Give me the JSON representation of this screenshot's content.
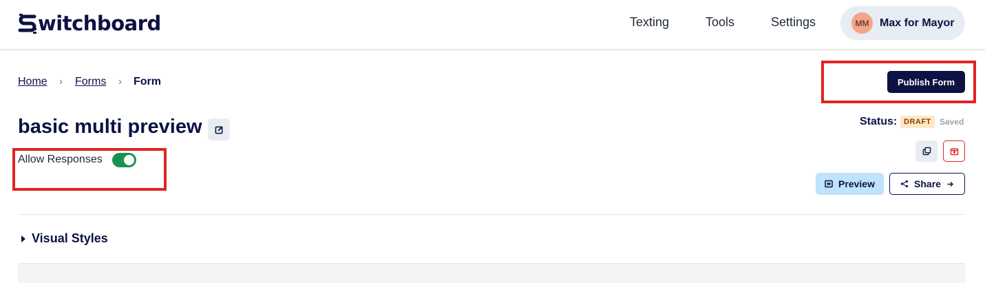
{
  "header": {
    "logo_text": "witchboard",
    "nav": [
      "Texting",
      "Tools",
      "Settings"
    ],
    "account": {
      "initials": "MM",
      "name": "Max for Mayor"
    }
  },
  "breadcrumb": {
    "home": "Home",
    "forms": "Forms",
    "current": "Form",
    "separator": "›"
  },
  "actions": {
    "publish_label": "Publish Form",
    "preview_label": "Preview",
    "share_label": "Share"
  },
  "form": {
    "title": "basic multi preview",
    "allow_responses_label": "Allow Responses",
    "allow_responses": true
  },
  "status": {
    "label": "Status:",
    "badge": "DRAFT",
    "saved": "Saved"
  },
  "sections": {
    "visual_styles": "Visual Styles"
  },
  "colors": {
    "brand_navy": "#0c1242",
    "toggle_on": "#19924f",
    "highlight_red": "#e02424",
    "preview_bg": "#bde4fb",
    "draft_bg": "#fde9c4"
  }
}
